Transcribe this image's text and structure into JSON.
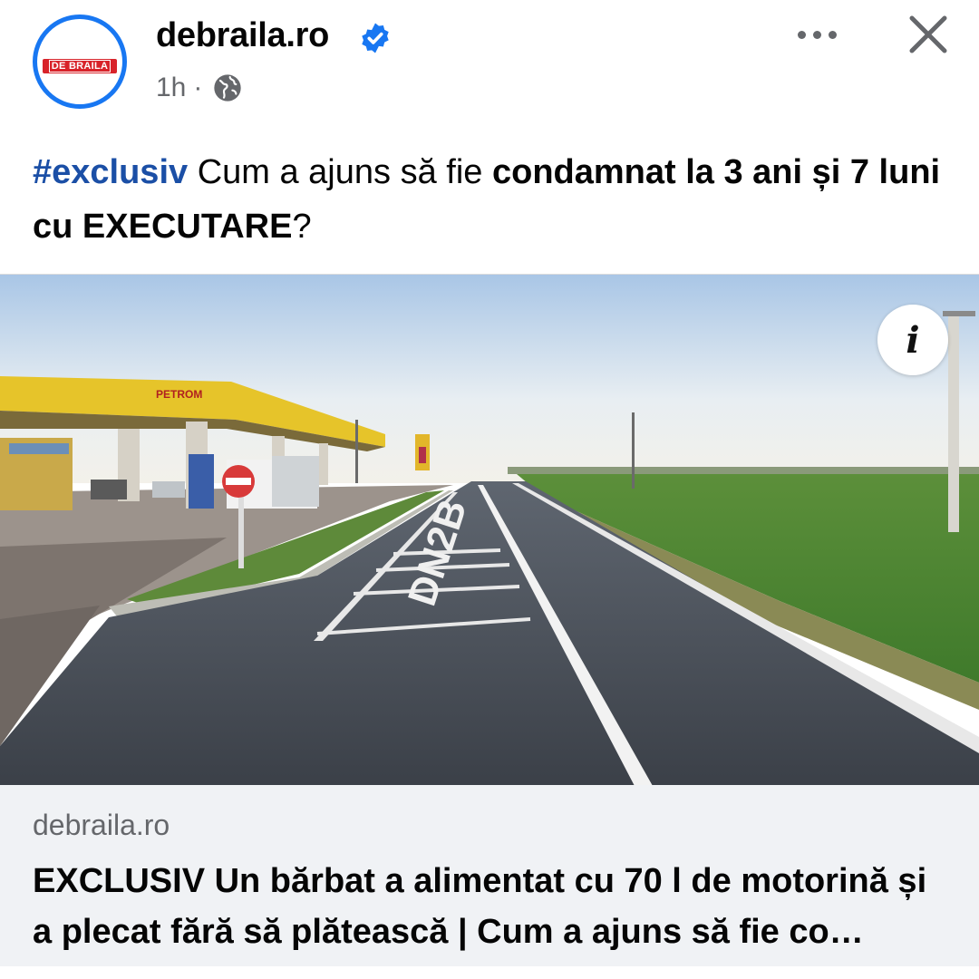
{
  "post": {
    "page_name": "debraila.ro",
    "avatar_text": "DE BRAILA",
    "time": "1h",
    "separator": "·",
    "audience_icon": "globe-icon",
    "verified_icon": "verified-badge-icon",
    "more_icon": "more-options-icon",
    "close_icon": "close-icon",
    "text": {
      "hashtag": "#exclusiv",
      "part1": " Cum a ajuns să fie ",
      "bold1": "condamnat la 3 ani și 7 luni cu EXECUTARE",
      "part2": "?"
    }
  },
  "image": {
    "sign_text": "PETROM",
    "road_marking": "DN2B",
    "info_button": "i"
  },
  "link_preview": {
    "domain": "debraila.ro",
    "title": "EXCLUSIV Un bărbat a alimentat cu 70 l de motorină și a plecat fără să plătească | Cum a ajuns să fie co…"
  },
  "colors": {
    "accent": "#1877f2",
    "hashtag": "#1b4fa6",
    "secondary_text": "#65676b",
    "card_bg": "#f0f2f5"
  }
}
